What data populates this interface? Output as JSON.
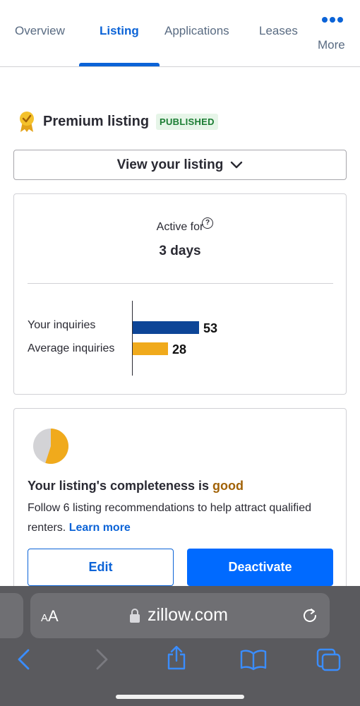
{
  "tabs": {
    "items": [
      {
        "label": "Overview"
      },
      {
        "label": "Listing"
      },
      {
        "label": "Applications"
      },
      {
        "label": "Leases"
      },
      {
        "label": "More"
      }
    ],
    "active": "Listing"
  },
  "listing": {
    "title": "Premium listing",
    "status": "PUBLISHED",
    "view_button": "View your listing"
  },
  "stats": {
    "active_for_label": "Active for",
    "help_symbol": "?",
    "active_for_value": "3 days",
    "your_inquiries_label": "Your inquiries",
    "your_inquiries": 53,
    "average_inquiries_label": "Average inquiries",
    "average_inquiries": 28
  },
  "completeness": {
    "title_prefix": "Your listing's completeness is ",
    "rating": "good",
    "description": "Follow 6 listing recommendations to help attract qualified renters. ",
    "learn_more": "Learn more",
    "fraction": 0.55,
    "edit_button": "Edit",
    "deactivate_button": "Deactivate"
  },
  "browser": {
    "text_size_label_small": "A",
    "text_size_label_large": "A",
    "url": "zillow.com"
  },
  "colors": {
    "accent": "#0b63d7",
    "primary_button": "#006aff",
    "your_bar": "#0d4597",
    "avg_bar": "#f0aa1c",
    "published_bg": "#e6f5e8",
    "published_text": "#1b7d33",
    "good_text": "#a16207"
  }
}
